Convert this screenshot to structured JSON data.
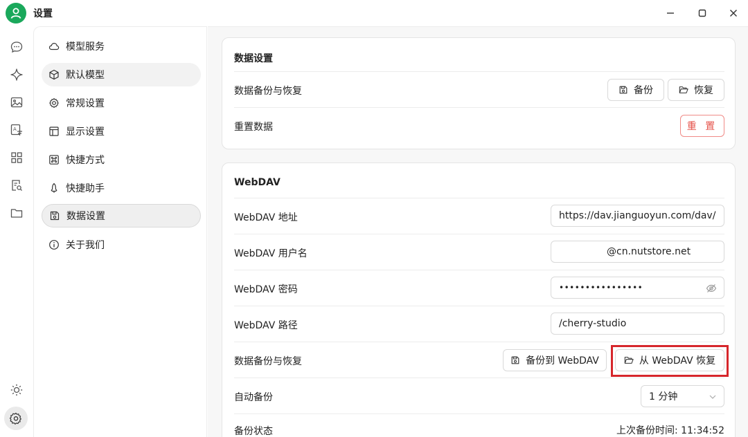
{
  "window": {
    "title": "设置",
    "controls": {
      "minimize": "minimize-icon",
      "maximize": "maximize-icon",
      "close": "close-icon"
    }
  },
  "rail": {
    "icons": [
      "chat-icon",
      "sparkle-icon",
      "image-icon",
      "translate-icon",
      "apps-icon",
      "doc-search-icon",
      "folder-icon",
      "sun-icon",
      "settings-icon"
    ]
  },
  "menu": {
    "items": [
      {
        "label": "模型服务",
        "icon": "cloud-icon"
      },
      {
        "label": "默认模型",
        "icon": "cube-icon"
      },
      {
        "label": "常规设置",
        "icon": "gear-icon"
      },
      {
        "label": "显示设置",
        "icon": "layout-icon"
      },
      {
        "label": "快捷方式",
        "icon": "command-icon"
      },
      {
        "label": "快捷助手",
        "icon": "rocket-icon"
      },
      {
        "label": "数据设置",
        "icon": "save-icon"
      },
      {
        "label": "关于我们",
        "icon": "info-icon"
      }
    ],
    "active_index": 6
  },
  "data_settings": {
    "title": "数据设置",
    "backup_row_label": "数据备份与恢复",
    "backup_button": "备份",
    "restore_button": "恢复",
    "reset_row_label": "重置数据",
    "reset_button": "重 置"
  },
  "webdav": {
    "title": "WebDAV",
    "url_label": "WebDAV 地址",
    "url_value": "https://dav.jianguoyun.com/dav/",
    "username_label": "WebDAV 用户名",
    "username_value": "@cn.nutstore.net",
    "password_label": "WebDAV 密码",
    "password_value": "••••••••••••••••",
    "path_label": "WebDAV 路径",
    "path_value": "/cherry-studio",
    "backup_row_label": "数据备份与恢复",
    "backup_button": "备份到 WebDAV",
    "restore_button": "从 WebDAV 恢复",
    "auto_backup_label": "自动备份",
    "auto_backup_value": "1 分钟",
    "status_label": "备份状态",
    "status_value": "上次备份时间: 11:34:52"
  },
  "colors": {
    "accent_green": "#1aa85b",
    "danger_red": "#e5524a",
    "highlight_red": "#d6262b"
  }
}
